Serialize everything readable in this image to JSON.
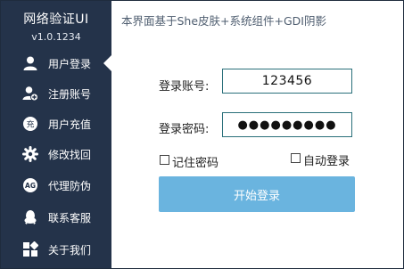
{
  "sidebar": {
    "app_title": "网络验证UI",
    "version": "v1.0.1234",
    "items": [
      {
        "label": "用户登录",
        "icon": "user-icon"
      },
      {
        "label": "注册账号",
        "icon": "user-add-icon"
      },
      {
        "label": "用户充值",
        "icon": "recharge-icon"
      },
      {
        "label": "修改找回",
        "icon": "gear-icon"
      },
      {
        "label": "代理防伪",
        "icon": "ag-badge-icon"
      },
      {
        "label": "联系客服",
        "icon": "qq-penguin-icon"
      },
      {
        "label": "关于我们",
        "icon": "apps-grid-icon"
      }
    ]
  },
  "header": {
    "text": "本界面基于She皮肤+系统组件+GDI阴影"
  },
  "form": {
    "account_label": "登录账号:",
    "account_value": "123456",
    "password_label": "登录密码:",
    "password_value": "●●●●●●●●●",
    "remember_label": "记住密码",
    "autologin_label": "自动登录",
    "login_button": "开始登录"
  },
  "colors": {
    "sidebar_bg": "#24334a",
    "button_bg": "#6ab4df",
    "input_border": "#2a6f7a"
  }
}
